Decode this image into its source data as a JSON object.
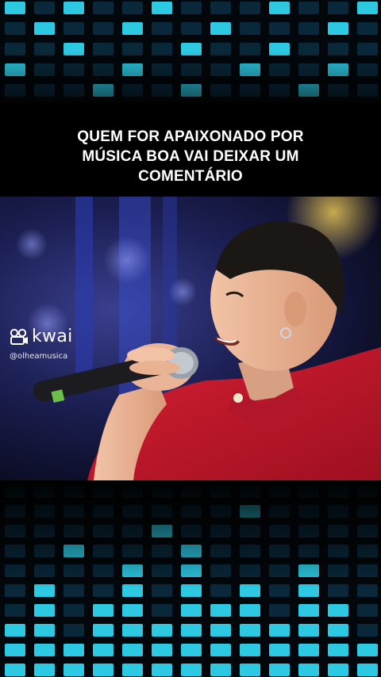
{
  "caption": {
    "line1": "QUEM FOR APAIXONADO POR",
    "line2": "MÚSICA BOA VAI DEIXAR UM",
    "line3": "COMENTÁRIO"
  },
  "watermark": {
    "brand": "kwai",
    "handle": "@olheamusica",
    "icon": "kwai-camera-icon"
  },
  "colors": {
    "eq_cyan": "#2fd3ee",
    "eq_blue": "#1e7fb8",
    "shirt_red": "#c4192b",
    "background": "#000000"
  }
}
